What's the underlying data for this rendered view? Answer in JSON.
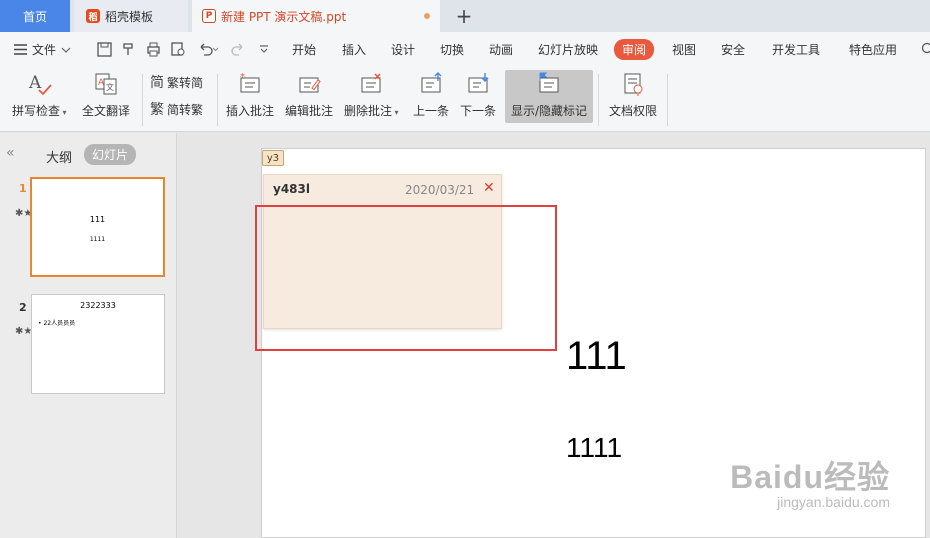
{
  "tabs": {
    "home": "首页",
    "template": "稻壳模板",
    "doc": "新建 PPT 演示文稿.ppt"
  },
  "menu": {
    "file": "文件",
    "items": [
      "开始",
      "插入",
      "设计",
      "切换",
      "动画",
      "幻灯片放映",
      "审阅",
      "视图",
      "安全",
      "开发工具",
      "特色应用"
    ],
    "active": "审阅"
  },
  "ribbon": {
    "spell_check": "拼写检查",
    "full_translate": "全文翻译",
    "trad_to_simp": "繁转简",
    "simp_to_trad": "简转繁",
    "insert_comment": "插入批注",
    "edit_comment": "编辑批注",
    "delete_comment": "删除批注",
    "prev": "上一条",
    "next": "下一条",
    "show_hide_markup": "显示/隐藏标记",
    "doc_permissions": "文档权限"
  },
  "panel": {
    "outline_tab": "大纲",
    "slides_tab": "幻灯片"
  },
  "slides": [
    {
      "num": "1",
      "title": "111",
      "body": "1111"
    },
    {
      "num": "2",
      "title": "2322333",
      "bullet": "• 22人员员员"
    }
  ],
  "slide_main": {
    "title": "111",
    "body": "1111"
  },
  "comment": {
    "marker": "y3",
    "author": "y483l",
    "date": "2020/03/21",
    "close": "✕"
  },
  "watermark": {
    "main": "Baidu经验",
    "sub": "jingyan.baidu.com"
  },
  "colors": {
    "accent": "#e8593d",
    "home_tab": "#4a86e8",
    "highlight_box": "#e04040",
    "comment_bg": "#f7ebe0"
  }
}
